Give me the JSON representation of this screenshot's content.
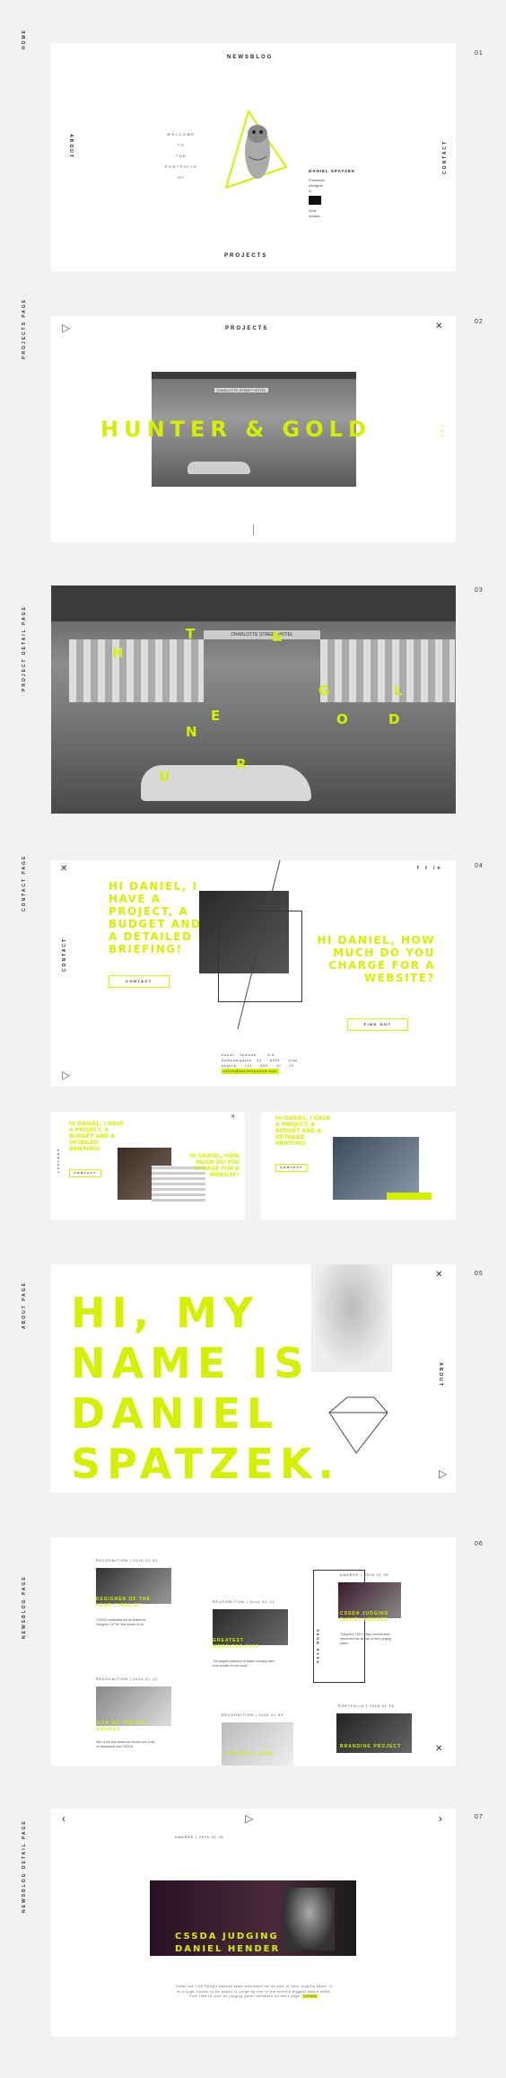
{
  "colors": {
    "accent": "#d4f000",
    "panel": "#ffffff",
    "background": "#f2f2f2"
  },
  "sections": [
    {
      "side_label": "HOME",
      "number": "01"
    },
    {
      "side_label": "PROJECTS PAGE",
      "number": "02"
    },
    {
      "side_label": "PROJECT DETAIL PAGE",
      "number": "03"
    },
    {
      "side_label": "CONTACT PAGE",
      "number": "04"
    },
    {
      "side_label": "ABOUT PAGE",
      "number": "05"
    },
    {
      "side_label": "NEWSBLOG PAGE",
      "number": "06"
    },
    {
      "side_label": "NEWSBLOG DETAIL PAGE",
      "number": "07"
    }
  ],
  "home": {
    "nav_top": "NEWSBLOG",
    "nav_bottom": "PROJECTS",
    "nav_left": "ABOUT",
    "nav_right": "CONTACT",
    "welcome_lines": [
      "WELCOME",
      "TO",
      "THE",
      "PORTFOLIO",
      "OF"
    ],
    "brand": "DANIEL SPATZEK",
    "roles": [
      "Freelance",
      "Designer",
      "in"
    ],
    "city": [
      "Graz",
      "Austria"
    ]
  },
  "projects": {
    "title": "PROJECTS",
    "project_name": "HUNTER & GOLD",
    "hotel_sign": "CHARLOTTE STREET HOTEL"
  },
  "project_detail": {
    "letters": [
      "H",
      "U",
      "N",
      "T",
      "E",
      "R",
      "&",
      "G",
      "O",
      "L",
      "D"
    ]
  },
  "contact": {
    "nav_left": "CONTACT",
    "headline_left": "HI DANIEL, I HAVE A PROJECT, A BUDGET AND A DETAILED BRIEFING!",
    "headline_right": "HI DANIEL, HOW MUCH DO YOU CHARGE FOR A WEBSITE?",
    "contact_button": "CONTACT",
    "find_out_button": "FIND OUT",
    "social": [
      "f",
      "t",
      "in"
    ],
    "address_lines": [
      "Daniel · Spatzek · · · A-8",
      "Kalbhaargasse · 23 · · 8020 · · Graz",
      "Austria · · +43 · · 699 · · 10 · · 20"
    ],
    "email": "office@danielspatzek.com"
  },
  "about": {
    "headline_lines": [
      "HI, MY",
      "NAME IS",
      "DANIEL",
      "SPATZEK."
    ],
    "nav_right": "ABOUT"
  },
  "newsblog": {
    "cards": [
      {
        "meta": "RECOGNITION | 2016 01 02",
        "title": "DESIGNER OF THE YEAR FINALIST",
        "text": "CSSDA nominated me as finalist for Designer Of The Year Award 2016"
      },
      {
        "meta": "RECOGNITION | 2016 01 14",
        "title": "GREATEST WEBSITES 2016",
        "text": "The largest collection of award winning sites ever curated in one book."
      },
      {
        "meta": "AWARDS | 2016 02 26",
        "title": "CSSDA JUDGING DANIEL HENDER",
        "text": "Today the CSS Design Awards team welcomed me as part of their judging panel"
      },
      {
        "meta": "RECOGNITION | 2016 01 12",
        "title": "SITE OF THE DAY AWARDS",
        "text": "Site of the Day Award for Hunter and Gold on Awwwards and CSSDA"
      },
      {
        "meta": "RECOGNITION | 2016 01 09",
        "title": "HUNTER & GOLD",
        "text": ""
      },
      {
        "meta": "PORTFOLIO | 2016 01 26",
        "title": "BRANDING PROJECT",
        "text": ""
      }
    ],
    "side_link": "READ MORE"
  },
  "newsblog_detail": {
    "meta": "AWARDS | 2016 02 26",
    "title_lines": [
      "CSSDA JUDGING",
      "DANIEL HENDER"
    ],
    "body": "Today the CSS Design Awards team welcomed me as part of their judging panel. It is a huge honour to be asked to judge by one of the world's biggest award sites! Feel free to visit all judging panel members on their page.",
    "link": "CSSDA"
  }
}
